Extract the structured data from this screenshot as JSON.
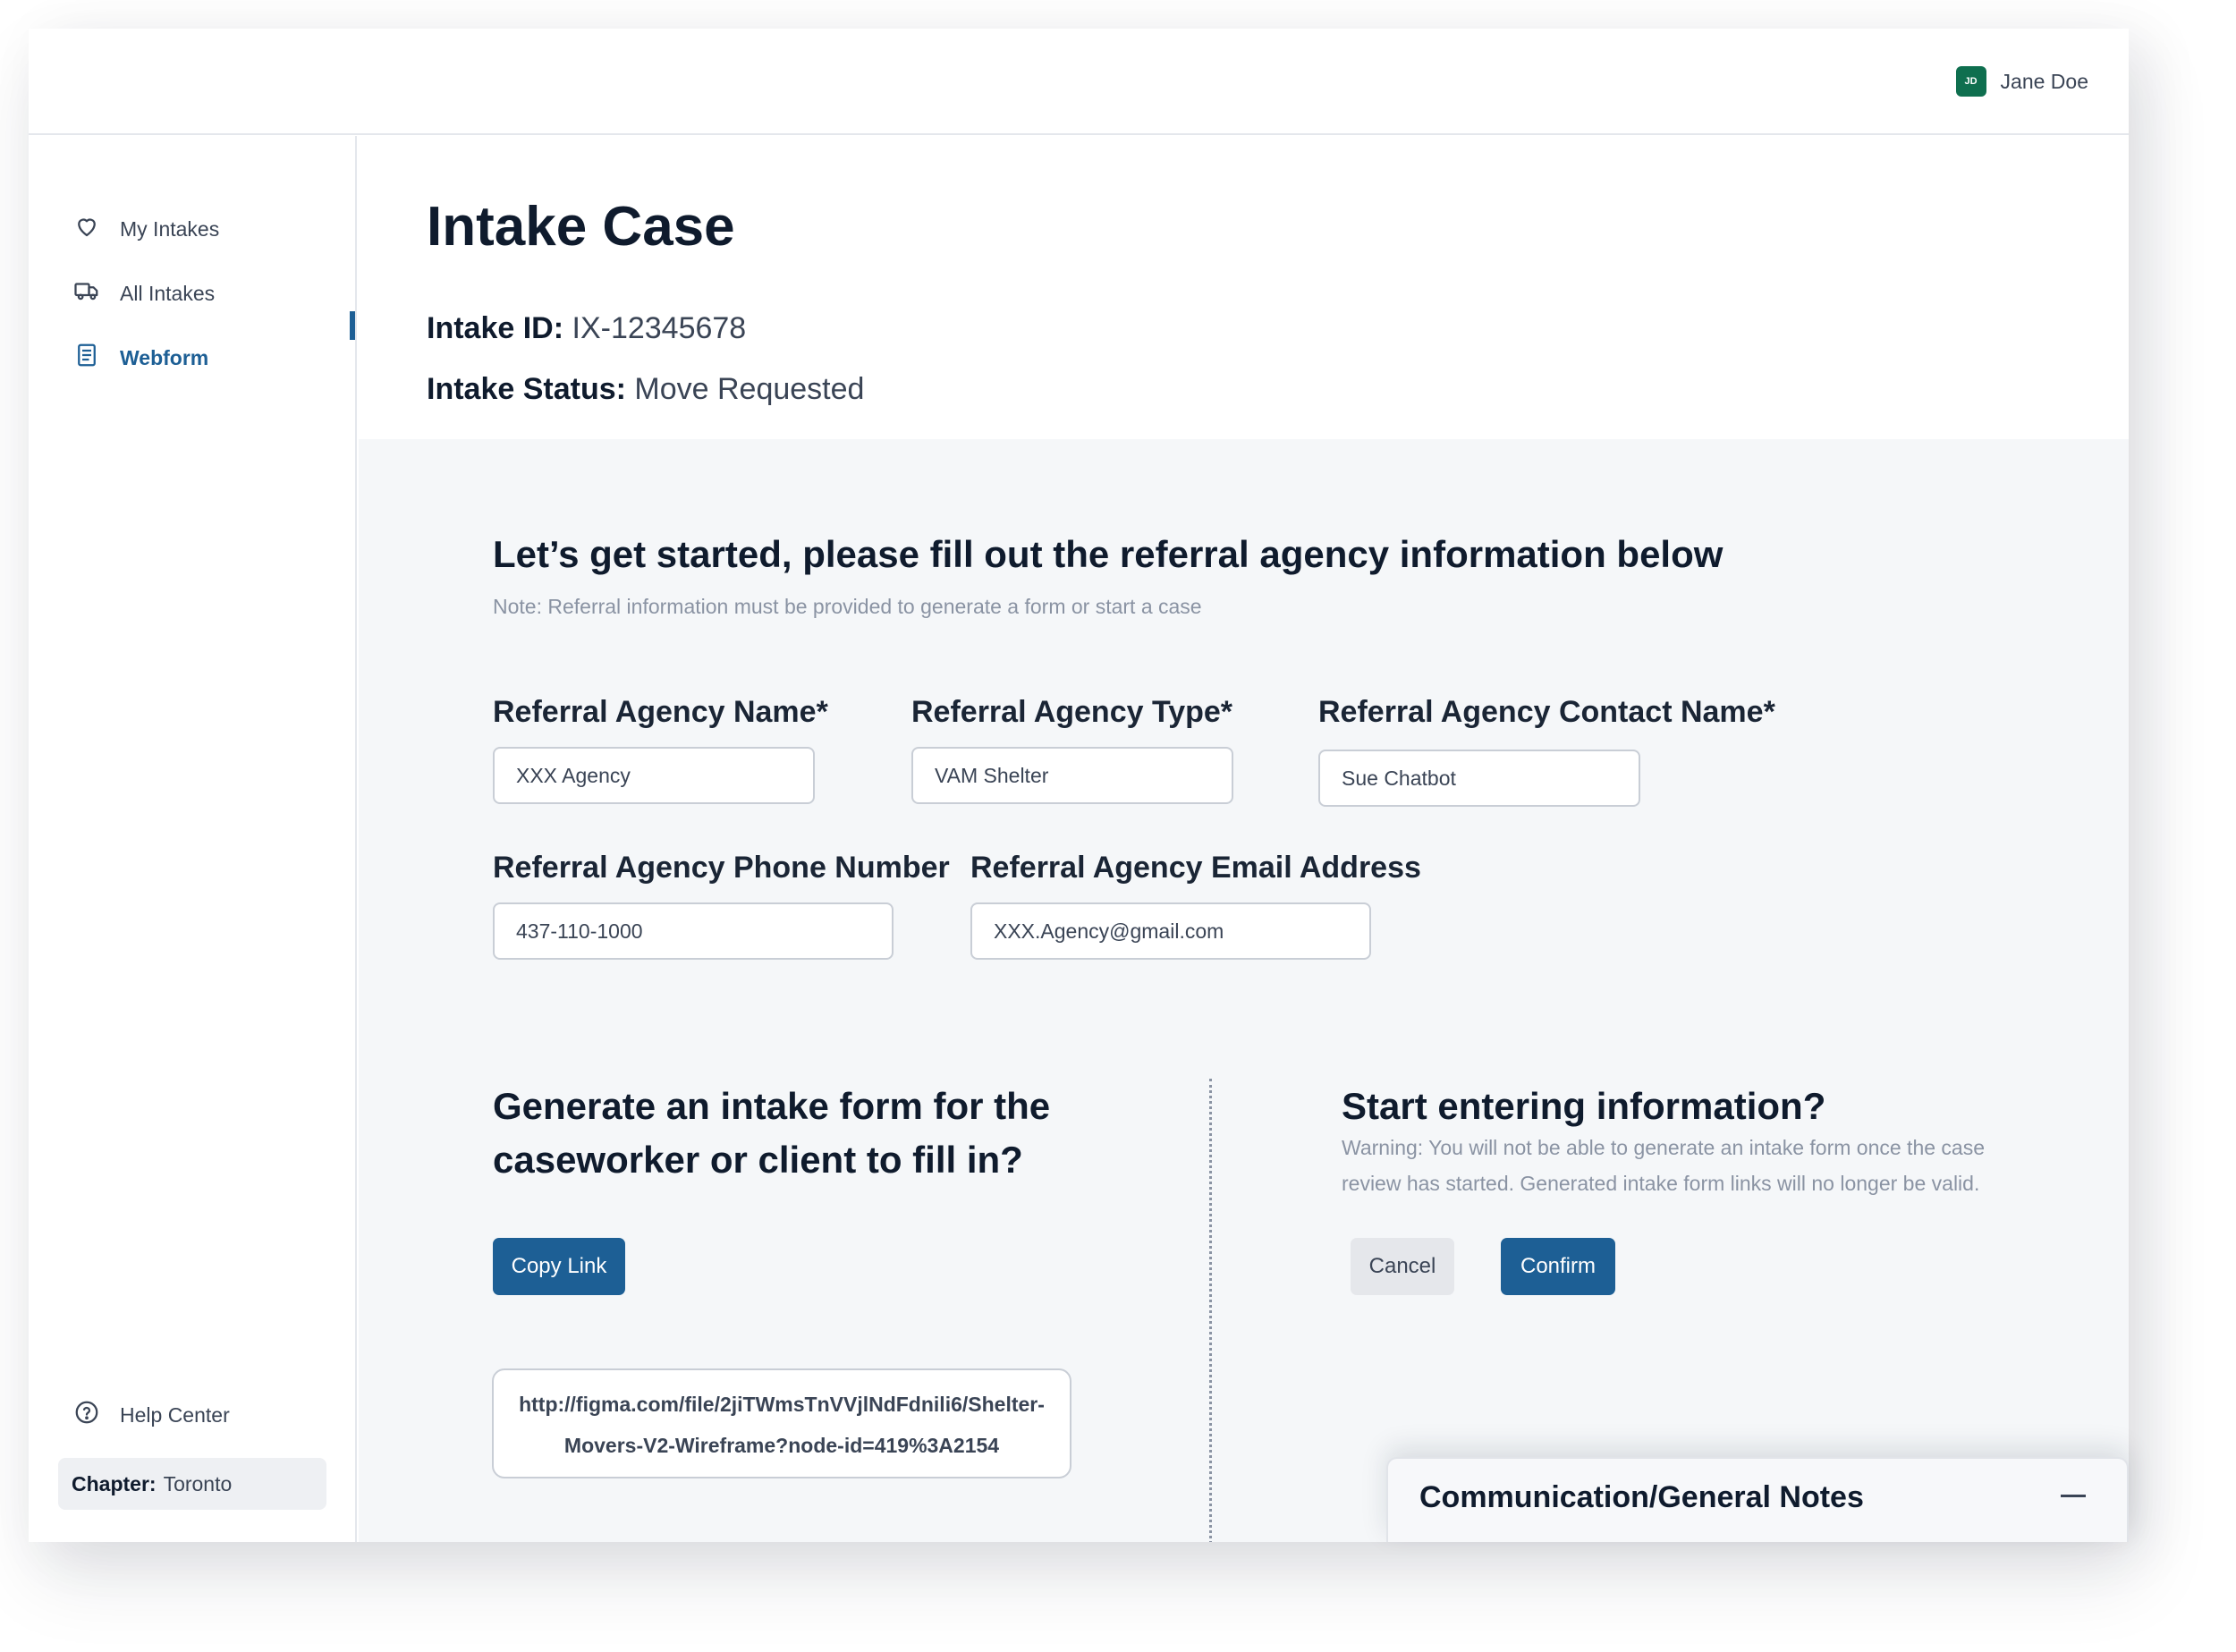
{
  "header": {
    "user": {
      "initials": "JD",
      "name": "Jane Doe"
    }
  },
  "sidebar": {
    "items": [
      {
        "label": "My Intakes",
        "icon": "heart-icon",
        "active": false
      },
      {
        "label": "All Intakes",
        "icon": "truck-icon",
        "active": false
      },
      {
        "label": "Webform",
        "icon": "document-list-icon",
        "active": true
      }
    ],
    "help": {
      "label": "Help Center",
      "icon": "question-circle-icon"
    },
    "chapter": {
      "key": "Chapter:",
      "value": "Toronto"
    }
  },
  "case": {
    "title": "Intake Case",
    "id_label": "Intake ID:",
    "id_value": "IX-12345678",
    "status_label": "Intake Status:",
    "status_value": "Move Requested"
  },
  "form": {
    "title": "Let’s get started, please fill out the referral agency information below",
    "note": "Note: Referral information must be provided to generate a form or start a case",
    "fields": {
      "agency_name": {
        "label": "Referral Agency Name*",
        "value": "XXX Agency"
      },
      "agency_type": {
        "label": "Referral Agency Type*",
        "value": "VAM Shelter"
      },
      "contact_name": {
        "label": "Referral Agency Contact Name*",
        "value": "Sue Chatbot"
      },
      "phone": {
        "label": "Referral Agency Phone Number",
        "value": "437-110-1000"
      },
      "email": {
        "label": "Referral Agency Email Address",
        "value": "XXX.Agency@gmail.com"
      }
    }
  },
  "generate": {
    "title_line1": "Generate an intake form for the",
    "title_line2": "caseworker or client to fill in?",
    "copy_button": "Copy Link",
    "link_line1": "http://figma.com/file/2jiTWmsTnVVjlNdFdnili6/Shelter-",
    "link_line2": "Movers-V2-Wireframe?node-id=419%3A2154"
  },
  "start": {
    "title": "Start entering information?",
    "warning_line1": "Warning: You will not be able to generate an intake form once the case",
    "warning_line2": "review has started. Generated intake form links will no longer be valid.",
    "cancel_button": "Cancel",
    "confirm_button": "Confirm"
  },
  "notes": {
    "title": "Communication/General Notes"
  },
  "colors": {
    "primary": "#1d5f95",
    "avatar": "#0f6f4f",
    "text_dark": "#0f1b2d",
    "text_muted": "#8a93a3",
    "content_bg": "#f5f7f9"
  }
}
